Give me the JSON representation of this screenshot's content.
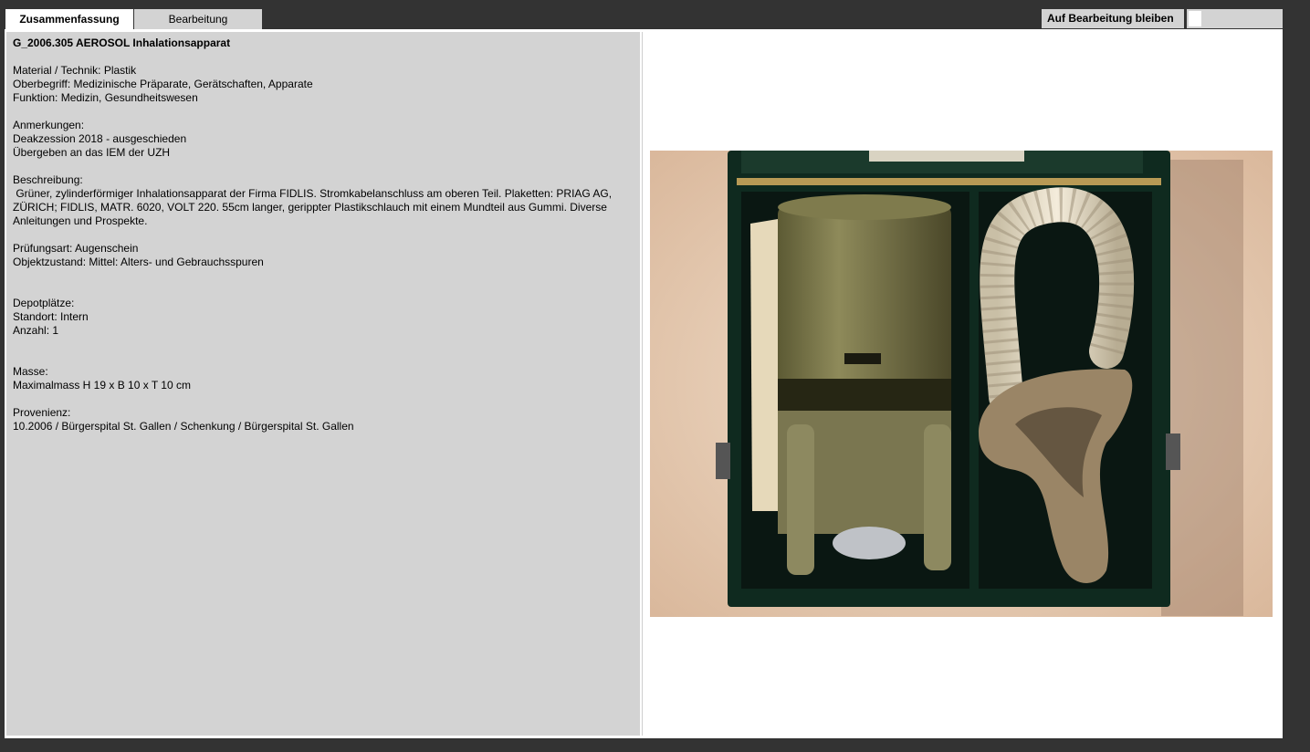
{
  "tabs": {
    "summary": "Zusammenfassung",
    "edit": "Bearbeitung"
  },
  "controls": {
    "stay_on_edit": "Auf Bearbeitung bleiben"
  },
  "record": {
    "title": "G_2006.305 AEROSOL Inhalationsapparat",
    "material": "Material / Technik: Plastik",
    "oberbegriff": "Oberbegriff: Medizinische Präparate, Gerätschaften, Apparate",
    "funktion": "Funktion: Medizin, Gesundheitswesen",
    "anmerkungen_label": "Anmerkungen:",
    "anmerkungen_1": "Deakzession 2018 - ausgeschieden",
    "anmerkungen_2": "Übergeben an das IEM der UZH",
    "beschreibung_label": "Beschreibung:",
    "beschreibung_text": " Grüner, zylinderförmiger Inhalationsapparat der Firma FIDLIS. Stromkabelanschluss am oberen Teil. Plaketten: PRIAG AG, ZÜRICH; FIDLIS, MATR. 6020, VOLT 220. 55cm langer, gerippter Plastikschlauch mit einem Mundteil aus Gummi. Diverse Anleitungen und Prospekte.",
    "pruefungsart": "Prüfungsart: Augenschein",
    "objektzustand": "Objektzustand: Mittel: Alters- und Gebrauchsspuren",
    "depot_label": "Depotplätze:",
    "standort": "Standort: Intern",
    "anzahl": "Anzahl: 1",
    "masse_label": "Masse:",
    "maximalmass": "Maximalmass H 19 x B 10 x T 10 cm",
    "provenienz_label": "Provenienz:",
    "provenienz": "10.2006 / Bürgerspital St. Gallen / Schenkung / Bürgerspital St. Gallen"
  },
  "colors": {
    "page_bg": "#333333",
    "panel_bg": "#d3d3d3",
    "active_tab": "#ffffff"
  }
}
